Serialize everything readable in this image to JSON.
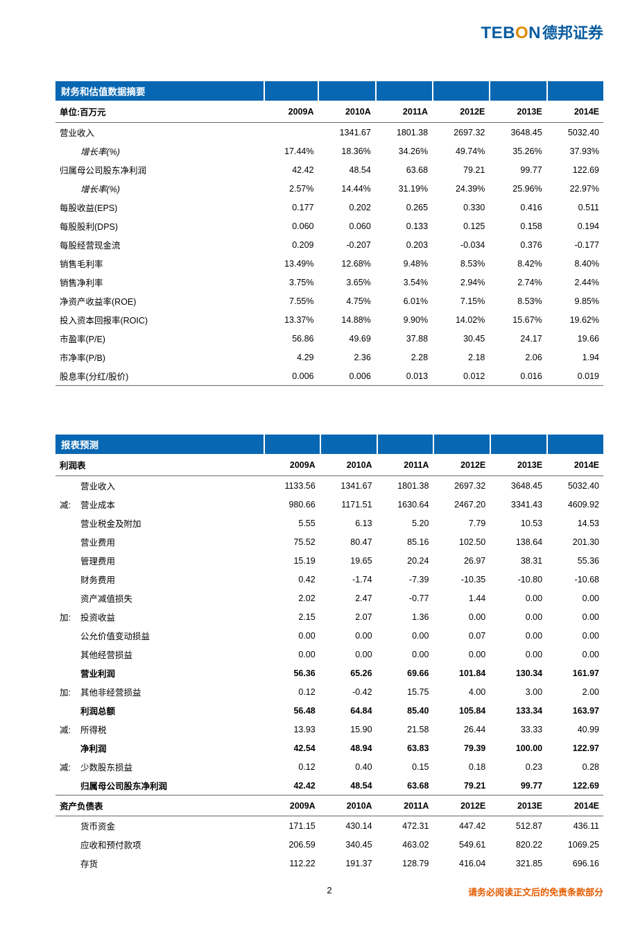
{
  "logo": {
    "text_en_pre": "TEB",
    "text_en_o": "O",
    "text_en_suf": "N",
    "text_cn": "德邦证券"
  },
  "footer": {
    "page": "2",
    "disclaimer": "请务必阅读正文后的免责条款部分"
  },
  "t1": {
    "title": "财务和估值数据摘要",
    "unit": "单位:百万元",
    "years": [
      "2009A",
      "2010A",
      "2011A",
      "2012E",
      "2013E",
      "2014E"
    ],
    "rows": [
      {
        "label": "营业收入",
        "indent": 0,
        "vals": [
          "",
          "1341.67",
          "1801.38",
          "2697.32",
          "3648.45",
          "5032.40"
        ]
      },
      {
        "label": "增长率(%)",
        "indent": 1,
        "italic": true,
        "vals": [
          "17.44%",
          "18.36%",
          "34.26%",
          "49.74%",
          "35.26%",
          "37.93%"
        ]
      },
      {
        "label": "归属母公司股东净利润",
        "indent": 0,
        "vals": [
          "42.42",
          "48.54",
          "63.68",
          "79.21",
          "99.77",
          "122.69"
        ]
      },
      {
        "label": "增长率(%)",
        "indent": 1,
        "italic": true,
        "vals": [
          "2.57%",
          "14.44%",
          "31.19%",
          "24.39%",
          "25.96%",
          "22.97%"
        ]
      },
      {
        "label": "每股收益(EPS)",
        "indent": 0,
        "vals": [
          "0.177",
          "0.202",
          "0.265",
          "0.330",
          "0.416",
          "0.511"
        ]
      },
      {
        "label": "每股股利(DPS)",
        "indent": 0,
        "vals": [
          "0.060",
          "0.060",
          "0.133",
          "0.125",
          "0.158",
          "0.194"
        ]
      },
      {
        "label": "每股经营现金流",
        "indent": 0,
        "vals": [
          "0.209",
          "-0.207",
          "0.203",
          "-0.034",
          "0.376",
          "-0.177"
        ]
      },
      {
        "label": "销售毛利率",
        "indent": 0,
        "vals": [
          "13.49%",
          "12.68%",
          "9.48%",
          "8.53%",
          "8.42%",
          "8.40%"
        ]
      },
      {
        "label": "销售净利率",
        "indent": 0,
        "vals": [
          "3.75%",
          "3.65%",
          "3.54%",
          "2.94%",
          "2.74%",
          "2.44%"
        ]
      },
      {
        "label": "净资产收益率(ROE)",
        "indent": 0,
        "vals": [
          "7.55%",
          "4.75%",
          "6.01%",
          "7.15%",
          "8.53%",
          "9.85%"
        ]
      },
      {
        "label": "投入资本回报率(ROIC)",
        "indent": 0,
        "vals": [
          "13.37%",
          "14.88%",
          "9.90%",
          "14.02%",
          "15.67%",
          "19.62%"
        ]
      },
      {
        "label": "市盈率(P/E)",
        "indent": 0,
        "vals": [
          "56.86",
          "49.69",
          "37.88",
          "30.45",
          "24.17",
          "19.66"
        ]
      },
      {
        "label": "市净率(P/B)",
        "indent": 0,
        "vals": [
          "4.29",
          "2.36",
          "2.28",
          "2.18",
          "2.06",
          "1.94"
        ]
      },
      {
        "label": "股息率(分红/股价)",
        "indent": 0,
        "vals": [
          "0.006",
          "0.006",
          "0.013",
          "0.012",
          "0.016",
          "0.019"
        ]
      }
    ]
  },
  "t2": {
    "title": "报表预测",
    "sub1": "利润表",
    "sub2": "资产负债表",
    "years": [
      "2009A",
      "2010A",
      "2011A",
      "2012E",
      "2013E",
      "2014E"
    ],
    "rows1": [
      {
        "prefix": "",
        "label": "营业收入",
        "bold": false,
        "vals": [
          "1133.56",
          "1341.67",
          "1801.38",
          "2697.32",
          "3648.45",
          "5032.40"
        ]
      },
      {
        "prefix": "减:",
        "label": "营业成本",
        "bold": false,
        "vals": [
          "980.66",
          "1171.51",
          "1630.64",
          "2467.20",
          "3341.43",
          "4609.92"
        ]
      },
      {
        "prefix": "",
        "label": "营业税金及附加",
        "bold": false,
        "vals": [
          "5.55",
          "6.13",
          "5.20",
          "7.79",
          "10.53",
          "14.53"
        ]
      },
      {
        "prefix": "",
        "label": "营业费用",
        "bold": false,
        "vals": [
          "75.52",
          "80.47",
          "85.16",
          "102.50",
          "138.64",
          "201.30"
        ]
      },
      {
        "prefix": "",
        "label": "管理费用",
        "bold": false,
        "vals": [
          "15.19",
          "19.65",
          "20.24",
          "26.97",
          "38.31",
          "55.36"
        ]
      },
      {
        "prefix": "",
        "label": "财务费用",
        "bold": false,
        "vals": [
          "0.42",
          "-1.74",
          "-7.39",
          "-10.35",
          "-10.80",
          "-10.68"
        ]
      },
      {
        "prefix": "",
        "label": "资产减值损失",
        "bold": false,
        "vals": [
          "2.02",
          "2.47",
          "-0.77",
          "1.44",
          "0.00",
          "0.00"
        ]
      },
      {
        "prefix": "加:",
        "label": "投资收益",
        "bold": false,
        "vals": [
          "2.15",
          "2.07",
          "1.36",
          "0.00",
          "0.00",
          "0.00"
        ]
      },
      {
        "prefix": "",
        "label": "公允价值变动损益",
        "bold": false,
        "vals": [
          "0.00",
          "0.00",
          "0.00",
          "0.07",
          "0.00",
          "0.00"
        ]
      },
      {
        "prefix": "",
        "label": "其他经营损益",
        "bold": false,
        "vals": [
          "0.00",
          "0.00",
          "0.00",
          "0.00",
          "0.00",
          "0.00"
        ]
      },
      {
        "prefix": "",
        "label": "营业利润",
        "bold": true,
        "vals": [
          "56.36",
          "65.26",
          "69.66",
          "101.84",
          "130.34",
          "161.97"
        ]
      },
      {
        "prefix": "加:",
        "label": "其他非经营损益",
        "bold": false,
        "vals": [
          "0.12",
          "-0.42",
          "15.75",
          "4.00",
          "3.00",
          "2.00"
        ]
      },
      {
        "prefix": "",
        "label": "利润总额",
        "bold": true,
        "vals": [
          "56.48",
          "64.84",
          "85.40",
          "105.84",
          "133.34",
          "163.97"
        ]
      },
      {
        "prefix": "减:",
        "label": "所得税",
        "bold": false,
        "vals": [
          "13.93",
          "15.90",
          "21.58",
          "26.44",
          "33.33",
          "40.99"
        ]
      },
      {
        "prefix": "",
        "label": "净利润",
        "bold": true,
        "vals": [
          "42.54",
          "48.94",
          "63.83",
          "79.39",
          "100.00",
          "122.97"
        ]
      },
      {
        "prefix": "减:",
        "label": "少数股东损益",
        "bold": false,
        "vals": [
          "0.12",
          "0.40",
          "0.15",
          "0.18",
          "0.23",
          "0.28"
        ]
      },
      {
        "prefix": "",
        "label": "归属母公司股东净利润",
        "bold": true,
        "vals": [
          "42.42",
          "48.54",
          "63.68",
          "79.21",
          "99.77",
          "122.69"
        ]
      }
    ],
    "rows2": [
      {
        "prefix": "",
        "label": "货币资金",
        "bold": false,
        "vals": [
          "171.15",
          "430.14",
          "472.31",
          "447.42",
          "512.87",
          "436.11"
        ]
      },
      {
        "prefix": "",
        "label": "应收和预付款项",
        "bold": false,
        "vals": [
          "206.59",
          "340.45",
          "463.02",
          "549.61",
          "820.22",
          "1069.25"
        ]
      },
      {
        "prefix": "",
        "label": "存货",
        "bold": false,
        "vals": [
          "112.22",
          "191.37",
          "128.79",
          "416.04",
          "321.85",
          "696.16"
        ]
      }
    ]
  }
}
